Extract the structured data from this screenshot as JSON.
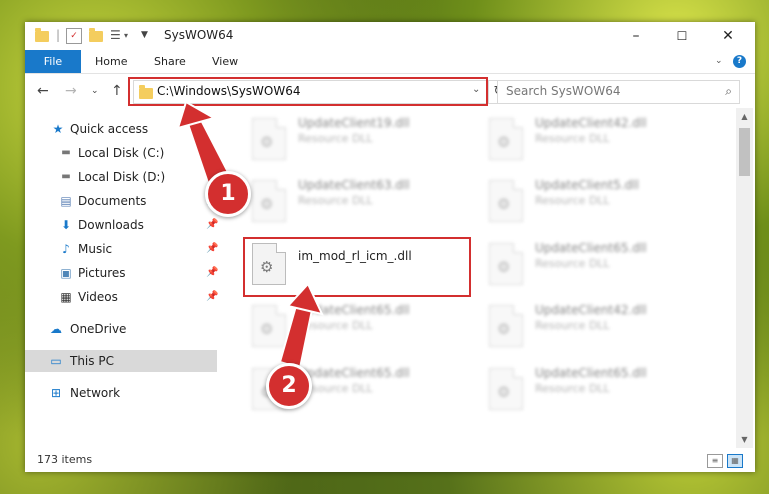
{
  "window": {
    "title": "SysWOW64",
    "controls": {
      "minimize": "–",
      "maximize": "☐",
      "close": "✕"
    }
  },
  "ribbon": {
    "tabs": [
      {
        "label": "File"
      },
      {
        "label": "Home"
      },
      {
        "label": "Share"
      },
      {
        "label": "View"
      }
    ]
  },
  "nav": {
    "address": "C:\\Windows\\SysWOW64",
    "search_placeholder": "Search SysWOW64"
  },
  "sidebar": {
    "items": [
      {
        "label": "Quick access",
        "icon": "star-icon",
        "pinned": false
      },
      {
        "label": "Local Disk (C:)",
        "icon": "drive-icon",
        "pinned": false
      },
      {
        "label": "Local Disk (D:)",
        "icon": "drive-icon",
        "pinned": false
      },
      {
        "label": "Documents",
        "icon": "documents-icon",
        "pinned": true
      },
      {
        "label": "Downloads",
        "icon": "download-icon",
        "pinned": true
      },
      {
        "label": "Music",
        "icon": "music-icon",
        "pinned": true
      },
      {
        "label": "Pictures",
        "icon": "pictures-icon",
        "pinned": true
      },
      {
        "label": "Videos",
        "icon": "videos-icon",
        "pinned": true
      },
      {
        "label": "OneDrive",
        "icon": "cloud-icon",
        "pinned": false
      },
      {
        "label": "This PC",
        "icon": "computer-icon",
        "pinned": false,
        "selected": true
      },
      {
        "label": "Network",
        "icon": "network-icon",
        "pinned": false
      }
    ]
  },
  "files": [
    {
      "name": "UpdateClient19.dll",
      "type": "Resource DLL",
      "blurred": true
    },
    {
      "name": "UpdateClient42.dll",
      "type": "Resource DLL",
      "blurred": true
    },
    {
      "name": "UpdateClient63.dll",
      "type": "Resource DLL",
      "blurred": true
    },
    {
      "name": "UpdateClient5.dll",
      "type": "Resource DLL",
      "blurred": true
    },
    {
      "name": "im_mod_rl_icm_.dll",
      "type": "",
      "blurred": false,
      "highlighted": true
    },
    {
      "name": "UpdateClient65.dll",
      "type": "Resource DLL",
      "blurred": true
    },
    {
      "name": "UpdateClient65.dll",
      "type": "Resource DLL",
      "blurred": true
    },
    {
      "name": "UpdateClient42.dll",
      "type": "Resource DLL",
      "blurred": true
    },
    {
      "name": "UpdateClient65.dll",
      "type": "Resource DLL",
      "blurred": true
    },
    {
      "name": "UpdateClient65.dll",
      "type": "Resource DLL",
      "blurred": true
    }
  ],
  "status": {
    "item_count": "173 items"
  },
  "annotations": {
    "step1": "1",
    "step2": "2",
    "color": "#d32f2f"
  }
}
